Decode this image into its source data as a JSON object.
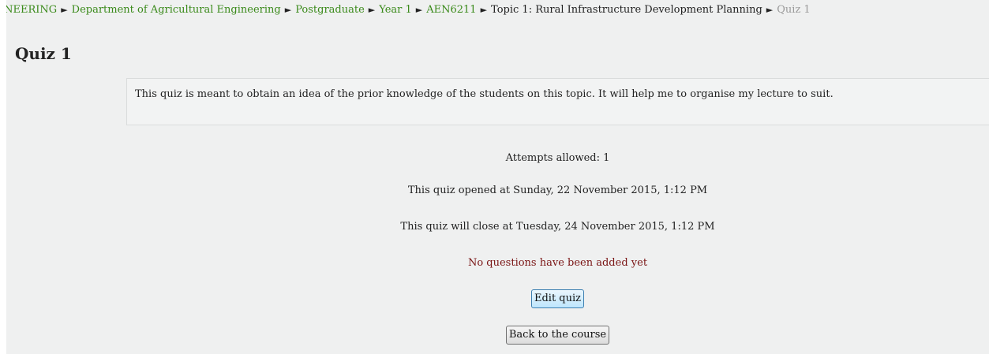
{
  "breadcrumb": {
    "items": [
      {
        "label": "INEERING"
      },
      {
        "label": "Department of Agricultural Engineering"
      },
      {
        "label": "Postgraduate"
      },
      {
        "label": "Year 1"
      },
      {
        "label": "AEN6211"
      },
      {
        "label": "Topic 1: Rural Infrastructure Development Planning"
      },
      {
        "label": "Quiz 1"
      }
    ],
    "separator": "►"
  },
  "page": {
    "title": "Quiz 1"
  },
  "intro": {
    "text": "This quiz is meant to obtain an idea of the prior knowledge of the students on this topic.  It will help me to organise my lecture to suit."
  },
  "quiz_info": {
    "attempts": "Attempts allowed: 1",
    "opened": "This quiz opened at Sunday, 22 November 2015, 1:12 PM",
    "closes": "This quiz will close at Tuesday, 24 November 2015, 1:12 PM",
    "warning": "No questions have been added yet"
  },
  "buttons": {
    "edit_quiz": "Edit quiz",
    "back_to_course": "Back to the course"
  },
  "colors": {
    "link": "#3a8a1a",
    "warning": "#7a1515",
    "background": "#eff0f0"
  }
}
